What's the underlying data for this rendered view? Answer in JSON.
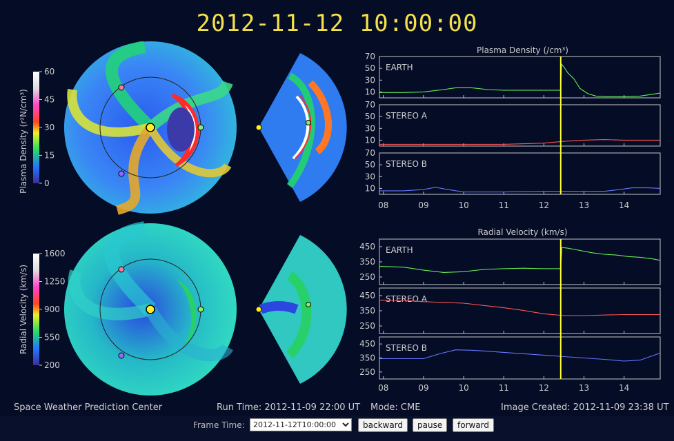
{
  "title": "2012-11-12  10:00:00",
  "colorbars": {
    "density": {
      "label": "Plasma Density (r²N/cm³)",
      "ticks": [
        "60",
        "45",
        "30",
        "15",
        "0"
      ]
    },
    "velocity": {
      "label": "Radial Velocity (km/s)",
      "ticks": [
        "1600",
        "1250",
        "900",
        "550",
        "200"
      ]
    }
  },
  "colors": {
    "background": "#050c26",
    "title": "#f3e04a",
    "earth": "#66ee55",
    "stereo_a": "#ff5555",
    "stereo_b": "#6677ff",
    "time_marker": "#ffff33",
    "frame": "#c8c8c8"
  },
  "chart_data": [
    {
      "type": "line",
      "title": "Plasma Density (/cm³)",
      "x_ticks": [
        "08",
        "09",
        "10",
        "11",
        "12",
        "13",
        "14"
      ],
      "xlim": [
        7.9,
        14.9
      ],
      "time_marker": 12.42,
      "panels": [
        {
          "label": "EARTH",
          "ylim": [
            0,
            70
          ],
          "yticks": [
            "70",
            "50",
            "30",
            "10"
          ],
          "x": [
            7.9,
            8.5,
            9.0,
            9.5,
            9.8,
            10.2,
            10.6,
            11.0,
            11.5,
            12.0,
            12.42,
            12.44,
            12.5,
            12.6,
            12.75,
            12.9,
            13.1,
            13.3,
            13.6,
            14.0,
            14.4,
            14.9
          ],
          "y": [
            9,
            9,
            10,
            14,
            17,
            17,
            14,
            13,
            13,
            13,
            13,
            57,
            52,
            42,
            32,
            16,
            7,
            3,
            2,
            2,
            3,
            8
          ]
        },
        {
          "label": "STEREO A",
          "ylim": [
            0,
            70
          ],
          "yticks": [
            "70",
            "50",
            "30",
            "10"
          ],
          "x": [
            7.9,
            8.5,
            9.0,
            10.0,
            11.0,
            11.5,
            12.0,
            12.5,
            13.0,
            13.5,
            14.0,
            14.9
          ],
          "y": [
            3,
            3,
            3,
            3,
            3,
            4,
            5,
            8,
            10,
            11,
            10,
            10
          ]
        },
        {
          "label": "STEREO B",
          "ylim": [
            0,
            70
          ],
          "yticks": [
            "70",
            "50",
            "30",
            "10"
          ],
          "x": [
            7.9,
            8.5,
            9.0,
            9.3,
            9.6,
            10.0,
            11.0,
            12.0,
            13.0,
            13.5,
            13.9,
            14.2,
            14.6,
            14.9
          ],
          "y": [
            6,
            6,
            8,
            12,
            8,
            4,
            4,
            5,
            5,
            5,
            8,
            11,
            11,
            10
          ]
        }
      ]
    },
    {
      "type": "line",
      "title": "Radial Velocity (km/s)",
      "x_ticks": [
        "08",
        "09",
        "10",
        "11",
        "12",
        "13",
        "14"
      ],
      "xlim": [
        7.9,
        14.9
      ],
      "time_marker": 12.42,
      "panels": [
        {
          "label": "EARTH",
          "ylim": [
            200,
            500
          ],
          "yticks": [
            "450",
            "350",
            "250"
          ],
          "x": [
            7.9,
            8.5,
            9.0,
            9.5,
            10.0,
            10.5,
            11.0,
            11.5,
            12.0,
            12.4,
            12.42,
            12.45,
            12.6,
            12.9,
            13.2,
            13.5,
            13.8,
            14.1,
            14.4,
            14.7,
            14.9
          ],
          "y": [
            320,
            315,
            295,
            280,
            285,
            300,
            305,
            308,
            305,
            305,
            305,
            445,
            440,
            425,
            410,
            400,
            395,
            385,
            380,
            370,
            360
          ]
        },
        {
          "label": "STEREO A",
          "ylim": [
            200,
            500
          ],
          "yticks": [
            "450",
            "350",
            "250"
          ],
          "x": [
            7.9,
            8.5,
            9.0,
            9.5,
            10.0,
            10.5,
            11.0,
            11.5,
            12.0,
            12.5,
            13.0,
            13.5,
            14.0,
            14.5,
            14.9
          ],
          "y": [
            420,
            418,
            410,
            405,
            400,
            385,
            370,
            352,
            330,
            318,
            318,
            322,
            325,
            325,
            325
          ]
        },
        {
          "label": "STEREO B",
          "ylim": [
            200,
            500
          ],
          "yticks": [
            "450",
            "350",
            "250"
          ],
          "x": [
            7.9,
            8.5,
            9.0,
            9.4,
            9.8,
            10.2,
            10.6,
            11.0,
            11.5,
            12.0,
            12.5,
            13.0,
            13.5,
            14.0,
            14.4,
            14.9
          ],
          "y": [
            345,
            345,
            345,
            380,
            408,
            405,
            398,
            390,
            380,
            370,
            360,
            350,
            340,
            328,
            335,
            385
          ]
        }
      ]
    }
  ],
  "footer": {
    "center": "Space Weather Prediction Center",
    "run_time": "Run Time: 2012-11-09 22:00 UT",
    "mode": "Mode: CME",
    "created": "Image Created: 2012-11-09 23:38 UT"
  },
  "controls": {
    "frame_label": "Frame Time:",
    "frame_value": "2012-11-12T10:00:00",
    "backward": "backward",
    "pause": "pause",
    "forward": "forward"
  }
}
